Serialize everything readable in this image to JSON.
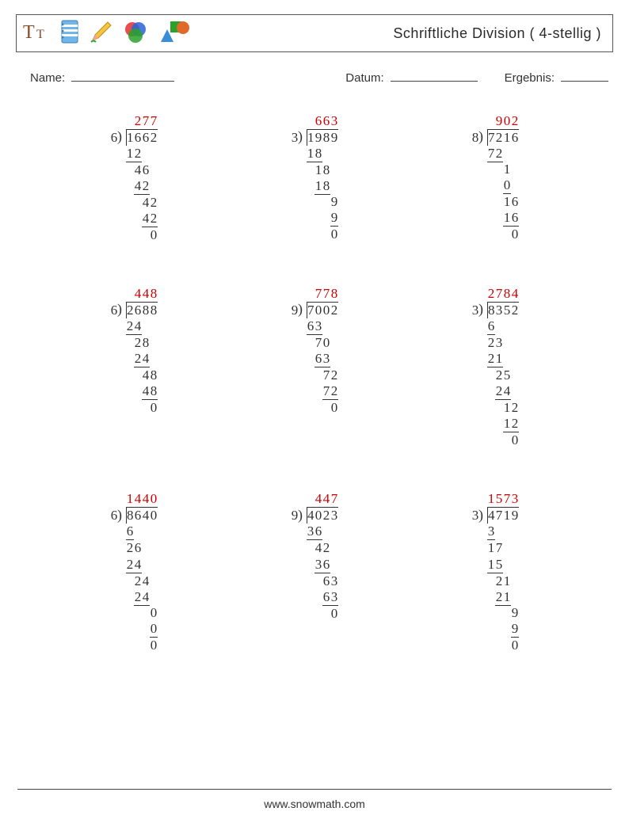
{
  "title": "Schriftliche Division ( 4-stellig )",
  "labels": {
    "name": "Name:",
    "date": "Datum:",
    "result": "Ergebnis:"
  },
  "footer": "www.snowmath.com",
  "icons": [
    "text-icon",
    "notebook-icon",
    "pencil-icon",
    "palette-icon",
    "shapes-icon"
  ],
  "problems": [
    {
      "divisor": "6",
      "dividend": "1662",
      "quotient": "277",
      "steps": [
        {
          "sub": "12",
          "subStart": 0,
          "subEnd": 1,
          "rem": "46",
          "remStart": 1,
          "remEnd": 2
        },
        {
          "sub": "42",
          "subStart": 1,
          "subEnd": 2,
          "rem": "42",
          "remStart": 2,
          "remEnd": 3
        },
        {
          "sub": "42",
          "subStart": 2,
          "subEnd": 3,
          "rem": "0",
          "remStart": 3,
          "remEnd": 3
        }
      ]
    },
    {
      "divisor": "3",
      "dividend": "1989",
      "quotient": "663",
      "steps": [
        {
          "sub": "18",
          "subStart": 0,
          "subEnd": 1,
          "rem": "18",
          "remStart": 1,
          "remEnd": 2
        },
        {
          "sub": "18",
          "subStart": 1,
          "subEnd": 2,
          "rem": "9",
          "remStart": 3,
          "remEnd": 3
        },
        {
          "sub": "9",
          "subStart": 3,
          "subEnd": 3,
          "rem": "0",
          "remStart": 3,
          "remEnd": 3
        }
      ]
    },
    {
      "divisor": "8",
      "dividend": "7216",
      "quotient": "902",
      "steps": [
        {
          "sub": "72",
          "subStart": 0,
          "subEnd": 1,
          "rem": "1",
          "remStart": 2,
          "remEnd": 2
        },
        {
          "sub": "0",
          "subStart": 2,
          "subEnd": 2,
          "rem": "16",
          "remStart": 2,
          "remEnd": 3
        },
        {
          "sub": "16",
          "subStart": 2,
          "subEnd": 3,
          "rem": "0",
          "remStart": 3,
          "remEnd": 3
        }
      ]
    },
    {
      "divisor": "6",
      "dividend": "2688",
      "quotient": "448",
      "steps": [
        {
          "sub": "24",
          "subStart": 0,
          "subEnd": 1,
          "rem": "28",
          "remStart": 1,
          "remEnd": 2
        },
        {
          "sub": "24",
          "subStart": 1,
          "subEnd": 2,
          "rem": "48",
          "remStart": 2,
          "remEnd": 3
        },
        {
          "sub": "48",
          "subStart": 2,
          "subEnd": 3,
          "rem": "0",
          "remStart": 3,
          "remEnd": 3
        }
      ]
    },
    {
      "divisor": "9",
      "dividend": "7002",
      "quotient": "778",
      "steps": [
        {
          "sub": "63",
          "subStart": 0,
          "subEnd": 1,
          "rem": "70",
          "remStart": 1,
          "remEnd": 2
        },
        {
          "sub": "63",
          "subStart": 1,
          "subEnd": 2,
          "rem": "72",
          "remStart": 2,
          "remEnd": 3
        },
        {
          "sub": "72",
          "subStart": 2,
          "subEnd": 3,
          "rem": "0",
          "remStart": 3,
          "remEnd": 3
        }
      ]
    },
    {
      "divisor": "3",
      "dividend": "8352",
      "quotient": "2784",
      "steps": [
        {
          "sub": "6",
          "subStart": 0,
          "subEnd": 0,
          "rem": "23",
          "remStart": 0,
          "remEnd": 1
        },
        {
          "sub": "21",
          "subStart": 0,
          "subEnd": 1,
          "rem": "25",
          "remStart": 1,
          "remEnd": 2
        },
        {
          "sub": "24",
          "subStart": 1,
          "subEnd": 2,
          "rem": "12",
          "remStart": 2,
          "remEnd": 3
        },
        {
          "sub": "12",
          "subStart": 2,
          "subEnd": 3,
          "rem": "0",
          "remStart": 3,
          "remEnd": 3
        }
      ]
    },
    {
      "divisor": "6",
      "dividend": "8640",
      "quotient": "1440",
      "steps": [
        {
          "sub": "6",
          "subStart": 0,
          "subEnd": 0,
          "rem": "26",
          "remStart": 0,
          "remEnd": 1
        },
        {
          "sub": "24",
          "subStart": 0,
          "subEnd": 1,
          "rem": "24",
          "remStart": 1,
          "remEnd": 2
        },
        {
          "sub": "24",
          "subStart": 1,
          "subEnd": 2,
          "rem": "0",
          "remStart": 3,
          "remEnd": 3
        },
        {
          "sub": "0",
          "subStart": 3,
          "subEnd": 3,
          "rem": "0",
          "remStart": 3,
          "remEnd": 3
        }
      ]
    },
    {
      "divisor": "9",
      "dividend": "4023",
      "quotient": "447",
      "steps": [
        {
          "sub": "36",
          "subStart": 0,
          "subEnd": 1,
          "rem": "42",
          "remStart": 1,
          "remEnd": 2
        },
        {
          "sub": "36",
          "subStart": 1,
          "subEnd": 2,
          "rem": "63",
          "remStart": 2,
          "remEnd": 3
        },
        {
          "sub": "63",
          "subStart": 2,
          "subEnd": 3,
          "rem": "0",
          "remStart": 3,
          "remEnd": 3
        }
      ]
    },
    {
      "divisor": "3",
      "dividend": "4719",
      "quotient": "1573",
      "steps": [
        {
          "sub": "3",
          "subStart": 0,
          "subEnd": 0,
          "rem": "17",
          "remStart": 0,
          "remEnd": 1
        },
        {
          "sub": "15",
          "subStart": 0,
          "subEnd": 1,
          "rem": "21",
          "remStart": 1,
          "remEnd": 2
        },
        {
          "sub": "21",
          "subStart": 1,
          "subEnd": 2,
          "rem": "9",
          "remStart": 3,
          "remEnd": 3
        },
        {
          "sub": "9",
          "subStart": 3,
          "subEnd": 3,
          "rem": "0",
          "remStart": 3,
          "remEnd": 3
        }
      ]
    }
  ]
}
